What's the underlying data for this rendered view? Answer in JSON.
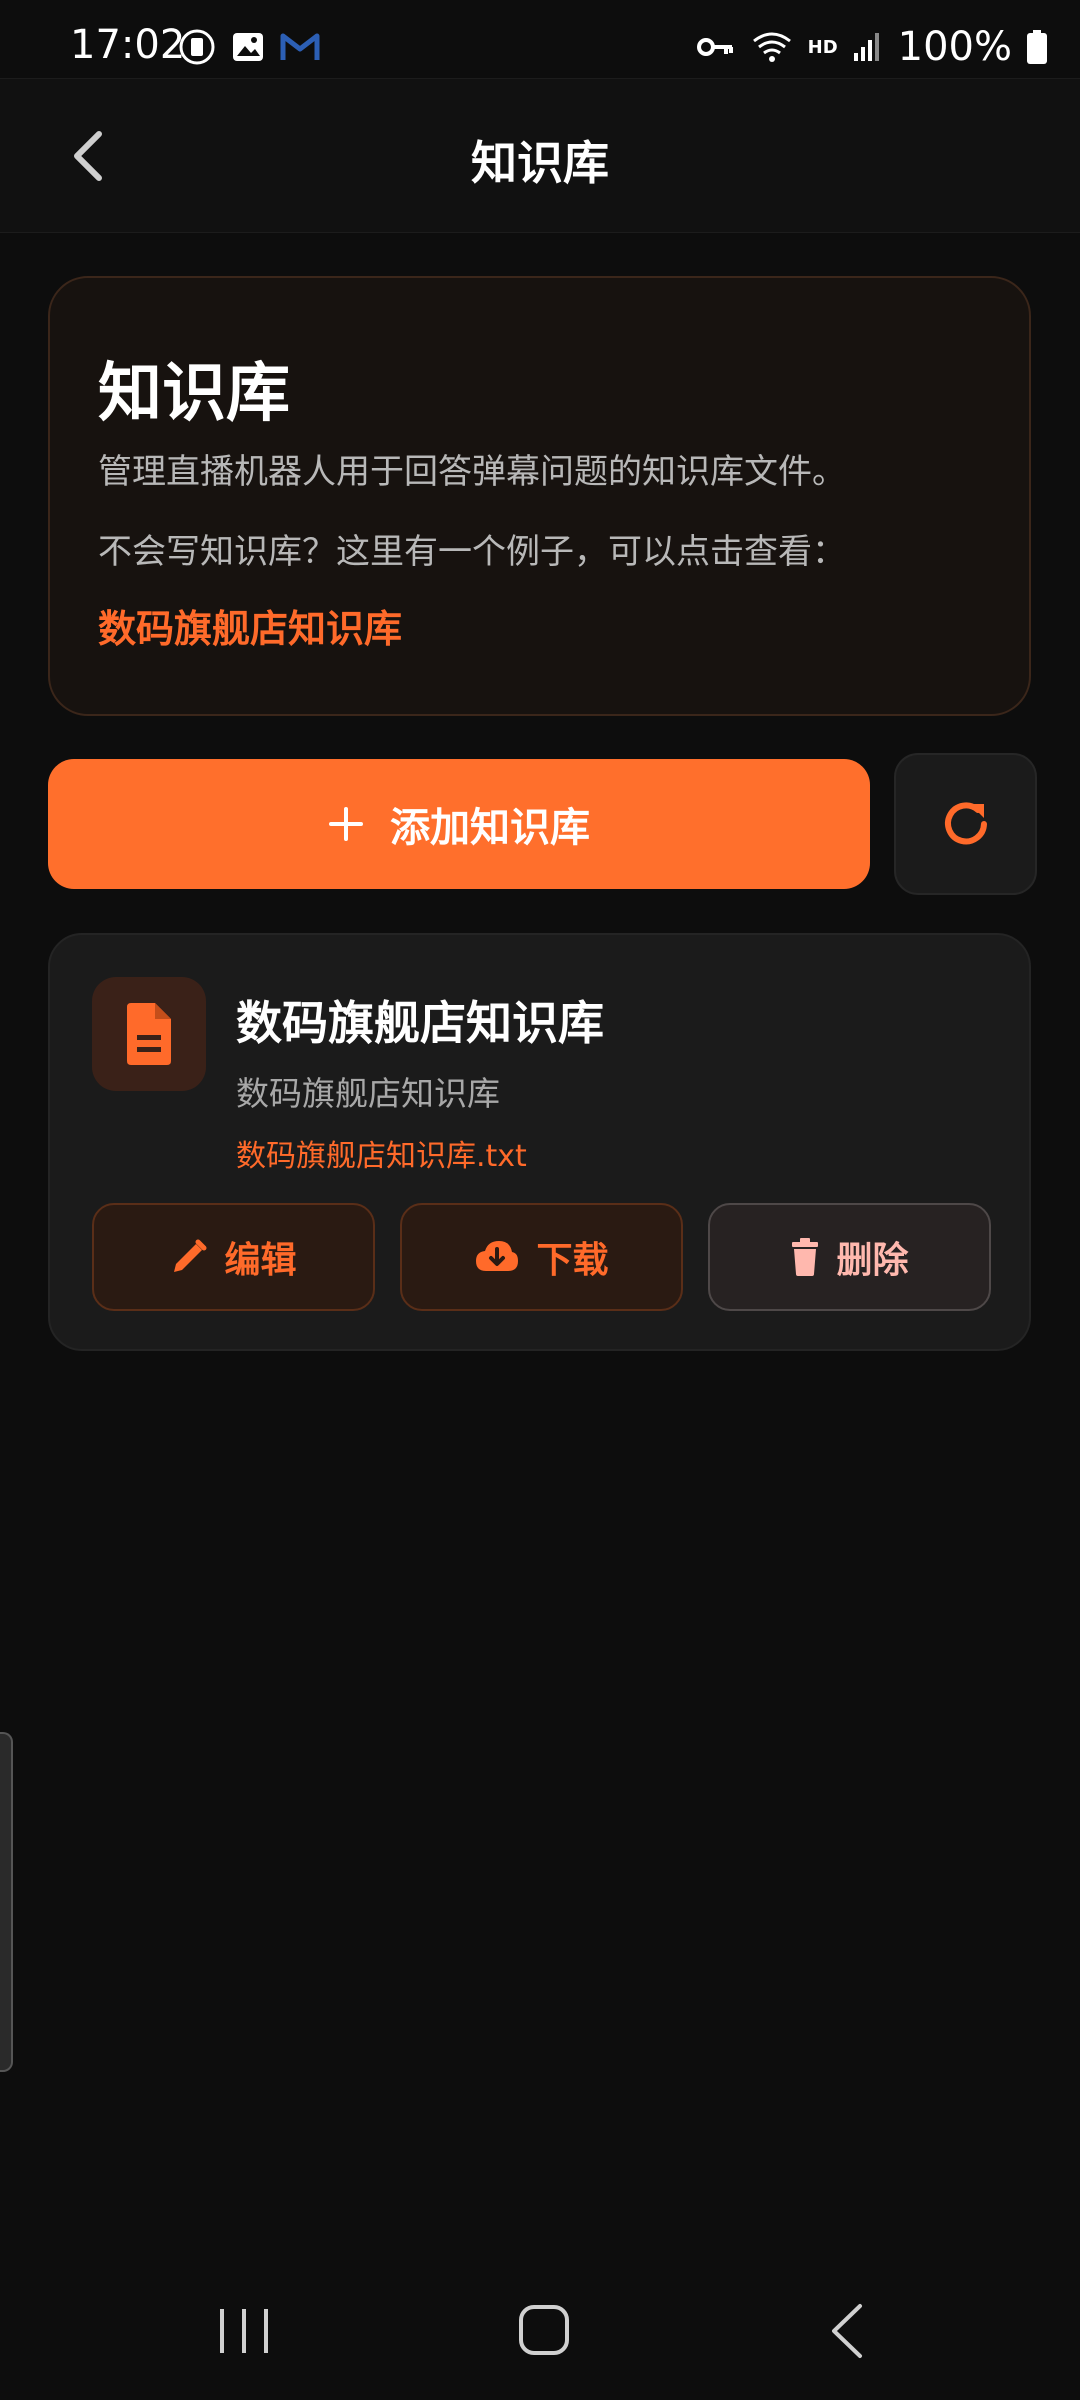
{
  "status_bar": {
    "time": "17:02",
    "battery_text": "100%",
    "network_label": "HD"
  },
  "app_bar": {
    "title": "知识库",
    "back_icon": "chevron-left-icon"
  },
  "intro": {
    "title": "知识库",
    "description": "管理直播机器人用于回答弹幕问题的知识库文件。",
    "example_prompt": "不会写知识库？这里有一个例子，可以点击查看：",
    "example_link": "数码旗舰店知识库"
  },
  "actions": {
    "add_label": "添加知识库",
    "add_icon": "plus-icon",
    "refresh_icon": "refresh-icon"
  },
  "knowledge_bases": [
    {
      "name": "数码旗舰店知识库",
      "description": "数码旗舰店知识库",
      "file": "数码旗舰店知识库.txt",
      "icon": "document-icon",
      "edit_label": "编辑",
      "download_label": "下载",
      "delete_label": "删除"
    }
  ],
  "colors": {
    "accent": "#ff6f2c",
    "background": "#0d0d0d",
    "card": "#1b1b1b",
    "danger_text": "#ffb8ae"
  }
}
